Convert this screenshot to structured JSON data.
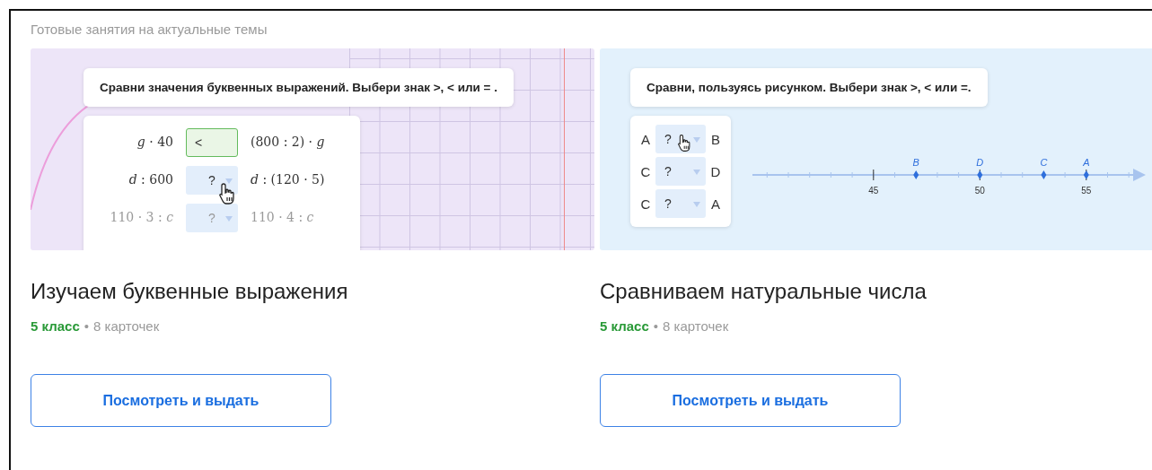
{
  "section_title": "Готовые занятия на актуальные темы",
  "lessons": [
    {
      "kind": "expressions",
      "preview": {
        "prompt": "Сравни значения буквенных выражений. Выбери знак >, < или = .",
        "rows": [
          {
            "left": "*g* · 40",
            "answer": "<",
            "correct": true,
            "right": "(800 : 2) · *g*",
            "cursor": false
          },
          {
            "left": "*d* : 600",
            "answer": "?",
            "correct": false,
            "right": "*d* : (120 · 5)",
            "cursor": true
          },
          {
            "left": "110 · 3 : *c*",
            "answer": "?",
            "correct": false,
            "right": "110 · 4 : *c*",
            "cursor": false
          }
        ]
      },
      "title": "Изучаем буквенные выражения",
      "grade": "5 класс",
      "separator": "•",
      "count": "8 карточек",
      "button": "Посмотреть и выдать"
    },
    {
      "kind": "number_line",
      "preview": {
        "prompt": "Сравни, пользуясь рисунком. Выбери знак >, < или =.",
        "rows": [
          {
            "left": "A",
            "answer": "?",
            "correct": false,
            "right": "B",
            "cursor": true
          },
          {
            "left": "C",
            "answer": "?",
            "correct": false,
            "right": "D",
            "cursor": false
          },
          {
            "left": "C",
            "answer": "?",
            "correct": false,
            "right": "A",
            "cursor": false
          }
        ],
        "ticks": [
          "45",
          "50",
          "55"
        ],
        "points": [
          {
            "label": "B"
          },
          {
            "label": "D"
          },
          {
            "label": "C"
          },
          {
            "label": "A"
          }
        ]
      },
      "title": "Сравниваем натуральные числа",
      "grade": "5 класс",
      "separator": "•",
      "count": "8 карточек",
      "button": "Посмотреть и выдать"
    }
  ]
}
